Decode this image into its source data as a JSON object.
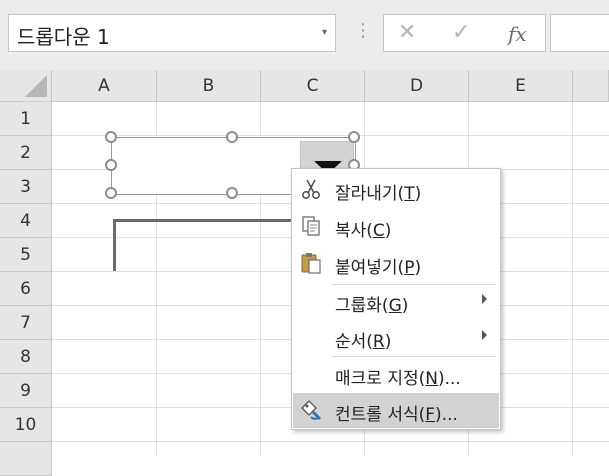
{
  "formula_bar": {
    "name_box_value": "드롭다운 1",
    "name_box_dropdown_glyph": "▾",
    "separator_glyph": "⋮",
    "cancel_glyph": "✕",
    "enter_glyph": "✓",
    "fx_glyph": "fx",
    "formula_value": ""
  },
  "columns": [
    "A",
    "B",
    "C",
    "D",
    "E"
  ],
  "rows": [
    "1",
    "2",
    "3",
    "4",
    "5",
    "6",
    "7",
    "8",
    "9",
    "10"
  ],
  "context_menu": {
    "items": [
      {
        "text": "잘라내기(",
        "key": "T",
        "tail": ")",
        "icon": "scissors-icon"
      },
      {
        "text": "복사(",
        "key": "C",
        "tail": ")",
        "icon": "copy-icon"
      },
      {
        "text": "붙여넣기(",
        "key": "P",
        "tail": ")",
        "icon": "paste-icon"
      },
      {
        "text": "그룹화(",
        "key": "G",
        "tail": ")",
        "submenu": true
      },
      {
        "text": "순서(",
        "key": "R",
        "tail": ")",
        "submenu": true
      },
      {
        "text": "매크로 지정(",
        "key": "N",
        "tail": ")...",
        "icon": ""
      },
      {
        "text": "컨트롤 서식(",
        "key": "F",
        "tail": ")...",
        "icon": "format-control-icon",
        "highlighted": true
      }
    ]
  },
  "colors": {
    "header_bg": "#e6e6e6",
    "menu_highlight": "#d2d2d2",
    "handle": "#8c8c8c"
  }
}
